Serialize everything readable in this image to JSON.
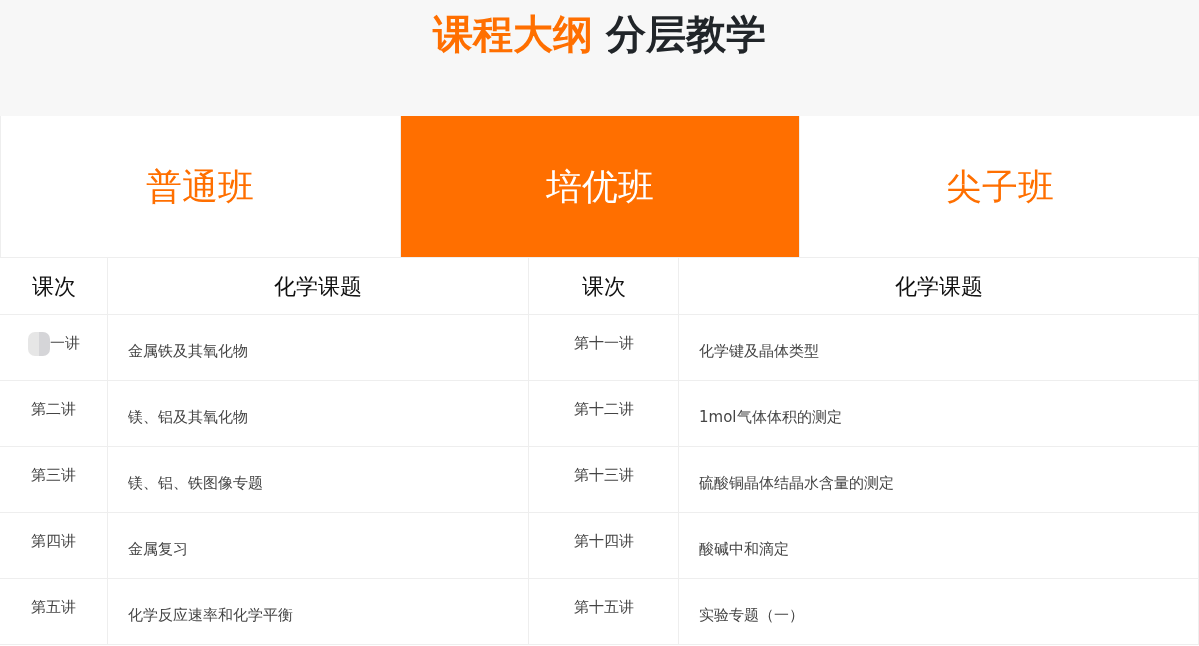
{
  "heading": {
    "accent": "课程大纲",
    "rest": "分层教学"
  },
  "tabs": [
    {
      "label": "普通班",
      "selected": false
    },
    {
      "label": "培优班",
      "selected": true
    },
    {
      "label": "尖子班",
      "selected": false
    }
  ],
  "table": {
    "columns": [
      "课次",
      "化学课题",
      "课次",
      "化学课题"
    ],
    "rows": [
      {
        "cells": [
          "一讲",
          "金属铁及其氧化物",
          "第十一讲",
          "化学键及晶体类型"
        ],
        "covered": true
      },
      {
        "cells": [
          "第二讲",
          "镁、铝及其氧化物",
          "第十二讲",
          "1mol气体体积的测定"
        ],
        "covered": false
      },
      {
        "cells": [
          "第三讲",
          "镁、铝、铁图像专题",
          "第十三讲",
          "硫酸铜晶体结晶水含量的测定"
        ],
        "covered": false
      },
      {
        "cells": [
          "第四讲",
          "金属复习",
          "第十四讲",
          "酸碱中和滴定"
        ],
        "covered": false
      },
      {
        "cells": [
          "第五讲",
          "化学反应速率和化学平衡",
          "第十五讲",
          "实验专题（一）"
        ],
        "covered": false
      }
    ]
  }
}
